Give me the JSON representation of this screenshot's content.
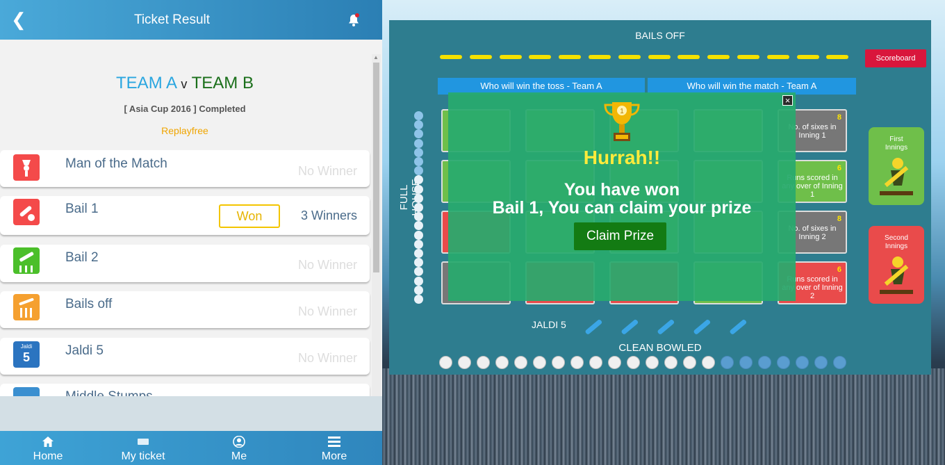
{
  "header": {
    "title": "Ticket Result",
    "back_icon": "chevron-left-icon",
    "bell_icon": "bell-icon"
  },
  "match": {
    "team_a": "TEAM A",
    "versus": "v",
    "team_b": "TEAM B",
    "tournament_status": "[ Asia Cup 2016 ] Completed",
    "replay_label": "Replayfree"
  },
  "results": [
    {
      "name": "Man of the Match",
      "status": "No Winner",
      "icon": "man-of-match-icon",
      "color": "#f44a4a"
    },
    {
      "name": "Bail 1",
      "badge": "Won",
      "status": "3 Winners",
      "icon": "bat-ball-icon",
      "color": "#f44a4a"
    },
    {
      "name": "Bail 2",
      "status": "No Winner",
      "icon": "stumps-icon",
      "color": "#4bbf2a"
    },
    {
      "name": "Bails off",
      "status": "No Winner",
      "icon": "bails-off-icon",
      "color": "#f5a030"
    },
    {
      "name": "Jaldi 5",
      "status": "No Winner",
      "icon": "jaldi-5-icon",
      "icon_text_top": "Jaldi",
      "icon_text_num": "5",
      "color": "#2b74c0"
    },
    {
      "name": "Middle Stumps",
      "icon": "middle-stumps-icon",
      "color": "#3a8fd0"
    }
  ],
  "bottom_nav": [
    {
      "label": "Home",
      "icon": "home-icon"
    },
    {
      "label": "My ticket",
      "icon": "ticket-icon"
    },
    {
      "label": "Me",
      "icon": "user-icon"
    },
    {
      "label": "More",
      "icon": "menu-icon"
    }
  ],
  "game_board": {
    "bails_off_label": "BAILS OFF",
    "scoreboard_label": "Scoreboard",
    "toss_question": "Who will win the toss - Team A",
    "match_question": "Who will win the match - Team A",
    "full_house_label": "FULL HOUSE",
    "jaldi_label": "JALDI 5",
    "clean_bowled_label": "CLEAN BOWLED",
    "first_innings_label": "First\nInnings",
    "second_innings_label": "Second\nInnings",
    "tiles": [
      {
        "num": "8",
        "text": "No. of sixes in Inning 1",
        "color": "gr"
      },
      {
        "num": "6",
        "text": "Runs scored in any over of Inning 1",
        "color": "g"
      },
      {
        "num": "8",
        "text": "No. of sixes in Inning 2",
        "color": "gr"
      },
      {
        "num": "6",
        "text": "Runs scored in any over of Inning 2",
        "color": "r"
      }
    ]
  },
  "popup": {
    "close_label": "×",
    "title": "Hurrah!!",
    "line1": "You have won",
    "line2": "Bail 1, You can claim your prize",
    "claim_button": "Claim Prize"
  }
}
